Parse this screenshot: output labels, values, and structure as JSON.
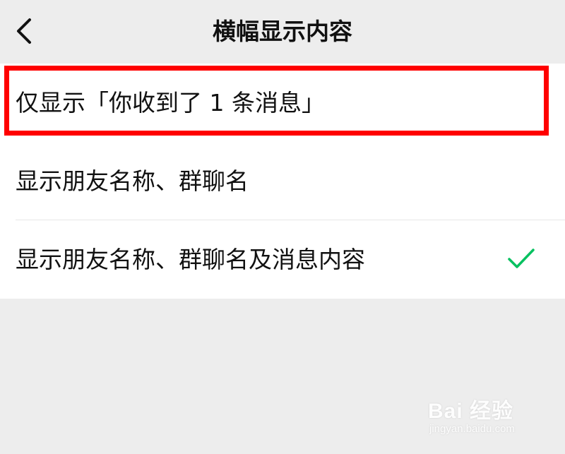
{
  "header": {
    "title": "横幅显示内容",
    "back_icon": "chevron-left-icon"
  },
  "options": [
    {
      "label": "仅显示「你收到了 1 条消息」",
      "selected": false,
      "highlighted": true
    },
    {
      "label": "显示朋友名称、群聊名",
      "selected": false,
      "highlighted": false
    },
    {
      "label": "显示朋友名称、群聊名及消息内容",
      "selected": true,
      "highlighted": false
    }
  ],
  "colors": {
    "background": "#ededed",
    "list_background": "#ffffff",
    "highlight_border": "#ff0000",
    "check": "#07c160"
  },
  "watermark": {
    "brand": "Bai 经验",
    "url": "jingyan.baidu.com"
  }
}
